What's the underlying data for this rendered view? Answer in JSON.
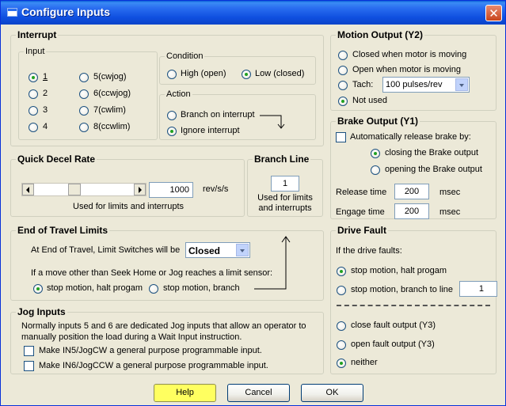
{
  "window": {
    "title": "Configure Inputs"
  },
  "interrupt": {
    "legend": "Interrupt",
    "input": {
      "legend": "Input",
      "options": [
        "1",
        "2",
        "3",
        "4",
        "5(cwjog)",
        "6(ccwjog)",
        "7(cwlim)",
        "8(ccwlim)"
      ],
      "selected": "1"
    },
    "condition": {
      "legend": "Condition",
      "high": "High (open)",
      "low": "Low (closed)",
      "selected": "Low (closed)"
    },
    "action": {
      "legend": "Action",
      "branch": "Branch on interrupt",
      "ignore": "Ignore interrupt",
      "selected": "Ignore interrupt"
    }
  },
  "quick_decel": {
    "legend": "Quick Decel Rate",
    "value": "1000",
    "unit": "rev/s/s",
    "note": "Used for limits and interrupts"
  },
  "branch_line": {
    "legend": "Branch Line",
    "value": "1",
    "note_line1": "Used for limits",
    "note_line2": "and interrupts"
  },
  "end_of_travel": {
    "legend": "End of Travel Limits",
    "label": "At End of Travel, Limit Switches will be",
    "state": "Closed",
    "sensor_text": "If a move other than Seek Home or Jog reaches a limit sensor:",
    "opt_halt": "stop motion, halt progam",
    "opt_branch": "stop motion, branch",
    "selected": "stop motion, halt progam"
  },
  "jog_inputs": {
    "legend": "Jog Inputs",
    "desc_line1": "Normally inputs 5 and 6 are dedicated Jog inputs that allow an operator to",
    "desc_line2": "manually position the load during a Wait Input instruction.",
    "in5": "Make IN5/JogCW a general purpose programmable input.",
    "in6": "Make IN6/JogCCW a general purpose programmable input."
  },
  "motion_output": {
    "legend": "Motion Output (Y2)",
    "opt_closed": "Closed when motor is moving",
    "opt_open": "Open when motor is moving",
    "opt_tach": "Tach:",
    "tach_value": "100 pulses/rev",
    "opt_not_used": "Not used",
    "selected": "Not used"
  },
  "brake_output": {
    "legend": "Brake Output (Y1)",
    "auto_label": "Automatically release brake by:",
    "opt_closing": "closing the Brake output",
    "opt_opening": "opening the Brake output",
    "selected": "closing the Brake output",
    "release_label": "Release time",
    "release_value": "200",
    "engage_label": "Engage time",
    "engage_value": "200",
    "unit": "msec"
  },
  "drive_fault": {
    "legend": "Drive Fault",
    "intro": "If the drive faults:",
    "opt_halt": "stop motion, halt progam",
    "opt_branch": "stop motion, branch to line",
    "branch_value": "1",
    "opt_close": "close fault output (Y3)",
    "opt_open": "open fault output (Y3)",
    "opt_neither": "neither",
    "selected_motion": "stop motion, halt progam",
    "selected_output": "neither"
  },
  "buttons": {
    "help": "Help",
    "cancel": "Cancel",
    "ok": "OK"
  }
}
